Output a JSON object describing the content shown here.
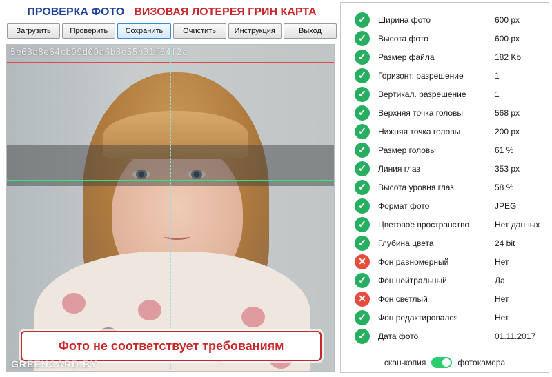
{
  "header": {
    "title_left": "ПРОВЕРКА ФОТО",
    "title_right": "ВИЗОВАЯ ЛОТЕРЕЯ ГРИН КАРТА"
  },
  "toolbar": {
    "buttons": [
      {
        "label": "Загрузить"
      },
      {
        "label": "Проверить"
      },
      {
        "label": "Сохранить"
      },
      {
        "label": "Очистить"
      },
      {
        "label": "Инструкция"
      },
      {
        "label": "Выход"
      }
    ],
    "active": "Сохранить"
  },
  "photo": {
    "hash": "5e63a8e64cb99d09a6b8e55b31f64f2c",
    "alert_text": "Фото не соответствует требованиям",
    "watermark": "GREENCARD.BY",
    "guide_colors": {
      "top": "#e04a4a",
      "eyes": "#2ee57a",
      "chin": "#3d6bdc",
      "center": "#8ee2e4"
    }
  },
  "params": [
    {
      "label": "Ширина фото",
      "value": "600 px",
      "status": "ok"
    },
    {
      "label": "Высота фото",
      "value": "600 px",
      "status": "ok"
    },
    {
      "label": "Размер файла",
      "value": "182 Kb",
      "status": "ok"
    },
    {
      "label": "Горизонт. разрешение",
      "value": "1",
      "status": "ok"
    },
    {
      "label": "Вертикал. разрешение",
      "value": "1",
      "status": "ok"
    },
    {
      "label": "Верхняя точка головы",
      "value": "568 px",
      "status": "ok"
    },
    {
      "label": "Нижняя точка головы",
      "value": "200 px",
      "status": "ok"
    },
    {
      "label": "Размер головы",
      "value": "61 %",
      "status": "ok"
    },
    {
      "label": "Линия глаз",
      "value": "353 px",
      "status": "ok"
    },
    {
      "label": "Высота уровня глаз",
      "value": "58 %",
      "status": "ok"
    },
    {
      "label": "Формат фото",
      "value": "JPEG",
      "status": "ok"
    },
    {
      "label": "Цветовое пространство",
      "value": "Нет данных",
      "status": "ok"
    },
    {
      "label": "Глубина цвета",
      "value": "24 bit",
      "status": "ok"
    },
    {
      "label": "Фон равномерный",
      "value": "Нет",
      "status": "bad"
    },
    {
      "label": "Фон нейтральный",
      "value": "Да",
      "status": "ok"
    },
    {
      "label": "Фон светлый",
      "value": "Нет",
      "status": "bad"
    },
    {
      "label": "Фон редактировался",
      "value": "Нет",
      "status": "ok"
    },
    {
      "label": "Дата фото",
      "value": "01.11.2017",
      "status": "ok"
    }
  ],
  "status_icons": {
    "ok": "check-icon",
    "bad": "cross-icon"
  },
  "status_colors": {
    "ok": "#27ae60",
    "bad": "#e74c3c"
  },
  "switch": {
    "left_label": "скан-копия",
    "right_label": "фотокамера",
    "state": "фотокамера"
  }
}
